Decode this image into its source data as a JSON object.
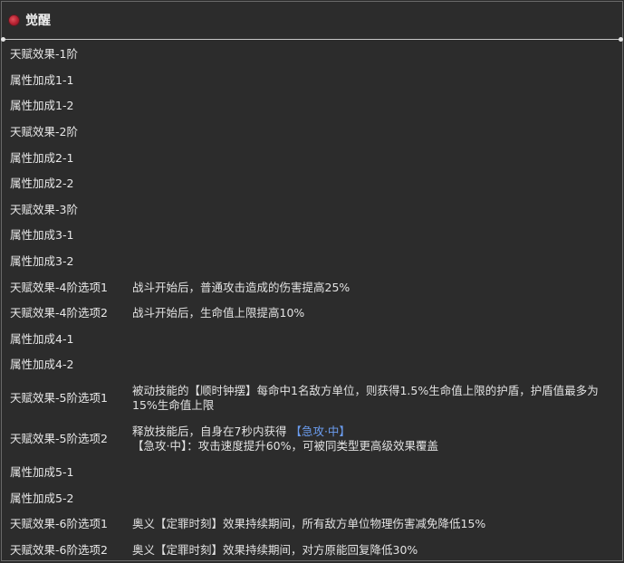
{
  "header": {
    "title": "觉醒"
  },
  "rows": [
    {
      "label": "天赋效果-1阶",
      "desc": ""
    },
    {
      "label": "属性加成1-1",
      "desc": ""
    },
    {
      "label": "属性加成1-2",
      "desc": ""
    },
    {
      "label": "天赋效果-2阶",
      "desc": ""
    },
    {
      "label": "属性加成2-1",
      "desc": ""
    },
    {
      "label": "属性加成2-2",
      "desc": ""
    },
    {
      "label": "天赋效果-3阶",
      "desc": ""
    },
    {
      "label": "属性加成3-1",
      "desc": ""
    },
    {
      "label": "属性加成3-2",
      "desc": ""
    },
    {
      "label": "天赋效果-4阶选项1",
      "desc": "战斗开始后，普通攻击造成的伤害提高25%"
    },
    {
      "label": "天赋效果-4阶选项2",
      "desc": "战斗开始后，生命值上限提高10%"
    },
    {
      "label": "属性加成4-1",
      "desc": ""
    },
    {
      "label": "属性加成4-2",
      "desc": ""
    },
    {
      "label": "天赋效果-5阶选项1",
      "desc": "被动技能的【顺时钟摆】每命中1名敌方单位，则获得1.5%生命值上限的护盾，护盾值最多为15%生命值上限"
    },
    {
      "label": "天赋效果-5阶选项2",
      "desc_line1": "释放技能后，自身在7秒内获得",
      "desc_highlight": "【急攻·中】",
      "desc_line2": "【急攻·中】：攻击速度提升60%，可被同类型更高级效果覆盖"
    },
    {
      "label": "属性加成5-1",
      "desc": ""
    },
    {
      "label": "属性加成5-2",
      "desc": ""
    },
    {
      "label": "天赋效果-6阶选项1",
      "desc": "奥义【定罪时刻】效果持续期间，所有敌方单位物理伤害减免降低15%"
    },
    {
      "label": "天赋效果-6阶选项2",
      "desc": "奥义【定罪时刻】效果持续期间，对方原能回复降低30%"
    }
  ]
}
